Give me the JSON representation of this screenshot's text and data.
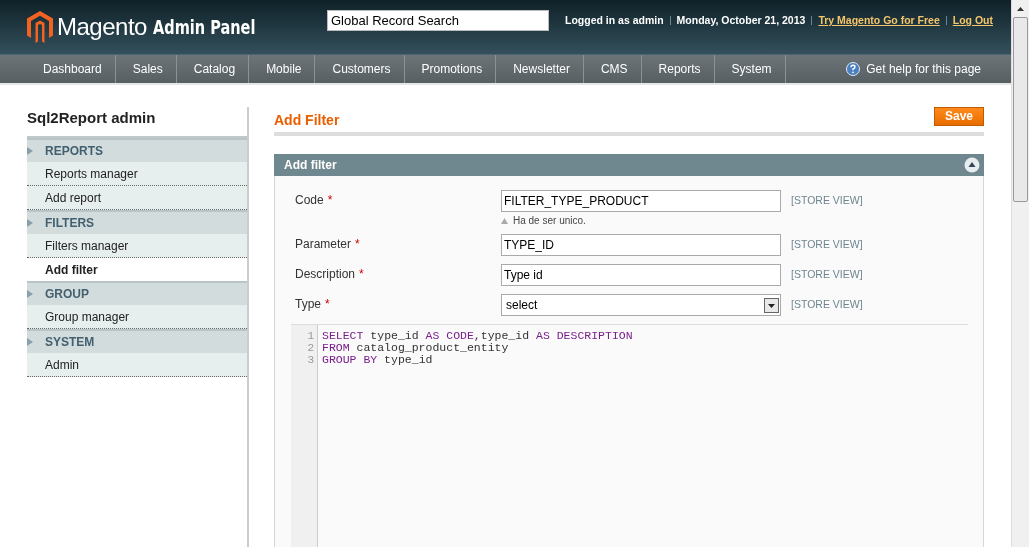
{
  "header": {
    "logo_text": "Magento",
    "logo_suffix": "Admin Panel",
    "search": {
      "value": "Global Record Search"
    },
    "user": "Logged in as admin",
    "date": "Monday, October 21, 2013",
    "links": [
      "Try Magento Go for Free",
      "Log Out"
    ]
  },
  "nav": {
    "items": [
      {
        "label": "Dashboard"
      },
      {
        "label": "Sales"
      },
      {
        "label": "Catalog"
      },
      {
        "label": "Mobile"
      },
      {
        "label": "Customers"
      },
      {
        "label": "Promotions"
      },
      {
        "label": "Newsletter"
      },
      {
        "label": "CMS"
      },
      {
        "label": "Reports"
      },
      {
        "label": "System"
      }
    ],
    "help": "Get help for this page"
  },
  "sidebar": {
    "title": "Sql2Report admin",
    "sections": [
      {
        "title": "REPORTS",
        "items": [
          {
            "label": "Reports manager",
            "selected": false
          },
          {
            "label": "Add report",
            "selected": false
          }
        ]
      },
      {
        "title": "FILTERS",
        "items": [
          {
            "label": "Filters manager",
            "selected": false
          },
          {
            "label": "Add filter",
            "selected": true
          }
        ]
      },
      {
        "title": "GROUP",
        "items": [
          {
            "label": "Group manager",
            "selected": false
          }
        ]
      },
      {
        "title": "SYSTEM",
        "items": [
          {
            "label": "Admin",
            "selected": false
          }
        ]
      }
    ]
  },
  "page": {
    "title": "Add Filter",
    "save": "Save"
  },
  "panel": {
    "title": "Add filter",
    "fields": [
      {
        "kind": "text",
        "label": "Code",
        "required": "*",
        "value": "FILTER_TYPE_PRODUCT",
        "note": "Ha de ser unico.",
        "scope": "[STORE VIEW]"
      },
      {
        "kind": "text",
        "label": "Parameter",
        "required": "*",
        "value": "TYPE_ID",
        "scope": "[STORE VIEW]"
      },
      {
        "kind": "text",
        "label": "Description",
        "required": "*",
        "value": "Type id",
        "scope": "[STORE VIEW]"
      },
      {
        "kind": "select",
        "label": "Type",
        "required": "*",
        "value": "select",
        "scope": "[STORE VIEW]"
      }
    ],
    "code": [
      {
        "number": "1",
        "tokens": [
          {
            "kind": "keyword",
            "text": "SELECT"
          },
          {
            "kind": "plain",
            "text": " type_id "
          },
          {
            "kind": "keyword",
            "text": "AS CODE"
          },
          {
            "kind": "plain",
            "text": ",type_id "
          },
          {
            "kind": "keyword",
            "text": "AS DESCRIPTION"
          }
        ]
      },
      {
        "number": "2",
        "tokens": [
          {
            "kind": "keyword",
            "text": "FROM"
          },
          {
            "kind": "plain",
            "text": " catalog_product_entity"
          }
        ]
      },
      {
        "number": "3",
        "tokens": [
          {
            "kind": "keyword",
            "text": "GROUP BY"
          },
          {
            "kind": "plain",
            "text": " type_id"
          }
        ]
      }
    ]
  }
}
